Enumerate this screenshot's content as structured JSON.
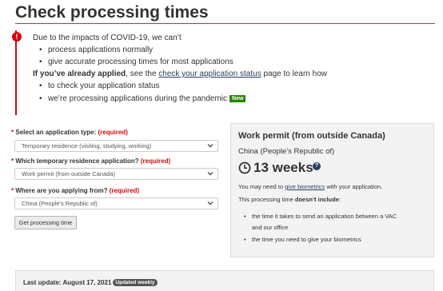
{
  "page": {
    "title": "Check processing times"
  },
  "alert": {
    "line1": "Due to the impacts of COVID-19, we can’t",
    "bullets1": [
      "process applications normally",
      "give accurate processing times for most applications"
    ],
    "applied_bold": "If you’ve already applied",
    "applied_pre": ", see the ",
    "applied_link": "check your application status",
    "applied_post": " page to learn how",
    "bullets2": [
      "to check your application status",
      "we’re processing applications during the pandemic"
    ],
    "new_badge": "New"
  },
  "form": {
    "required_star": "*",
    "required_text": "(required)",
    "fields": [
      {
        "label": "Select an application type:",
        "value": "Temporary residence (visiting, studying, working)"
      },
      {
        "label": "Which temporary residence application?",
        "value": "Work permit (from outside Canada)"
      },
      {
        "label": "Where are you applying from?",
        "value": "China (People's Republic of)"
      }
    ],
    "submit_label": "Get processing time"
  },
  "result": {
    "title": "Work permit (from outside Canada)",
    "country": "China (People’s Republic of)",
    "time": "13 weeks",
    "help": "?",
    "biometrics_pre": "You may need to ",
    "biometrics_link": "give biometrics",
    "biometrics_post": " with your application.",
    "excl_pre": "This processing time ",
    "excl_bold": "doesn’t include",
    "excl_post": ":",
    "bullet1_line1": "the time it takes to send an application between a VAC",
    "bullet1_line2": "and our office",
    "bullet2": "the time you need to give your biometrics"
  },
  "footer": {
    "last_update": "Last update: August 17, 2021",
    "badge": "Updated weekly"
  },
  "colors": {
    "title_rule": "#af3c43",
    "alert_red": "#d3080c",
    "link": "#284162",
    "new_badge": "#278400"
  },
  "icons": {
    "alert": "exclamation-circle-icon",
    "chevron": "chevron-down-icon",
    "clock": "clock-icon",
    "help": "question-circle-icon"
  }
}
